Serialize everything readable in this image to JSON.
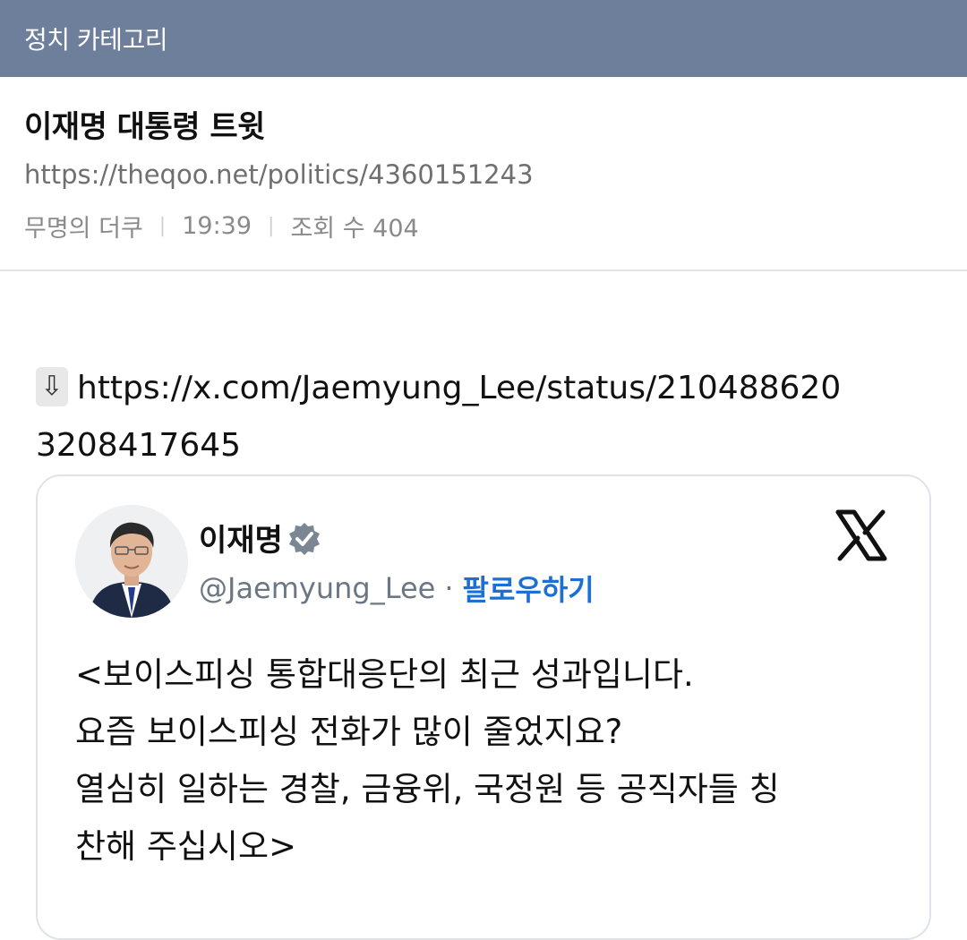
{
  "topbar": {
    "category": "정치 카테고리"
  },
  "post": {
    "title": "이재명 대통령 트윗",
    "url": "https://theqoo.net/politics/4360151243",
    "author": "무명의 더쿠",
    "time": "19:39",
    "views_label": "조회 수 404"
  },
  "content": {
    "link_text": "https://x.com/Jaemyung_Lee/status/2104886203208417645",
    "link_line1": "https://x.com/Jaemyung_Lee/status/210488620",
    "link_line2": "3208417645"
  },
  "tweet": {
    "author_name": "이재명",
    "handle": "@Jaemyung_Lee",
    "separator": "·",
    "follow_label": "팔로우하기",
    "text_lines": [
      "<보이스피싱 통합대응단의 최근 성과입니다.",
      "요즘 보이스피싱 전화가 많이 줄었지요?",
      "열심히 일하는 경찰, 금융위, 국정원 등 공직자들 칭",
      "찬해 주십시오>"
    ]
  },
  "icons": {
    "download": "download-arrow-icon",
    "verified": "verified-badge-icon",
    "platform": "x-logo-icon"
  },
  "colors": {
    "topbar": "#6e7f9c",
    "follow": "#1d6fd6",
    "verified": "#7a8793"
  }
}
